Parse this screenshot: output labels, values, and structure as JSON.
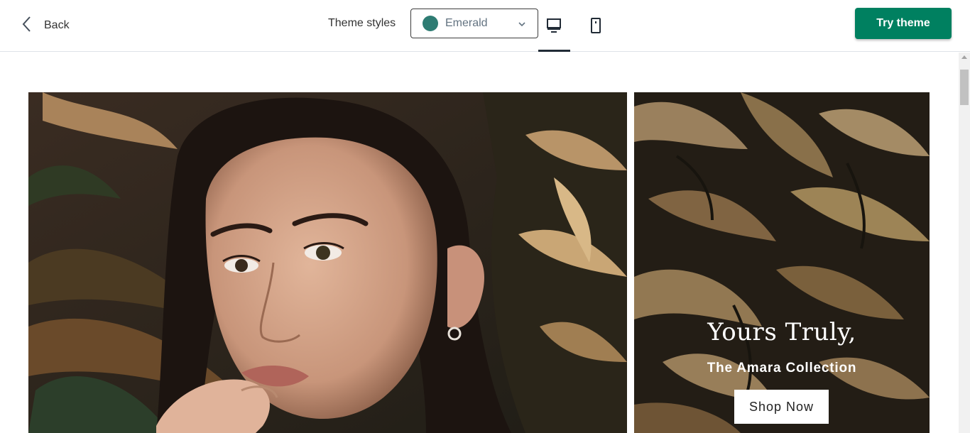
{
  "header": {
    "back_label": "Back",
    "styles_label": "Theme styles",
    "style_select": {
      "value": "Emerald",
      "swatch_color": "#2e7c73"
    },
    "devices": [
      {
        "name": "desktop",
        "active": true
      },
      {
        "name": "mobile",
        "active": false
      }
    ],
    "try_label": "Try theme"
  },
  "preview": {
    "side_banner": {
      "title": "Yours Truly,",
      "subtitle": "The Amara Collection",
      "button_label": "Shop Now"
    }
  },
  "colors": {
    "accent": "#008060",
    "text": "#212b36"
  }
}
